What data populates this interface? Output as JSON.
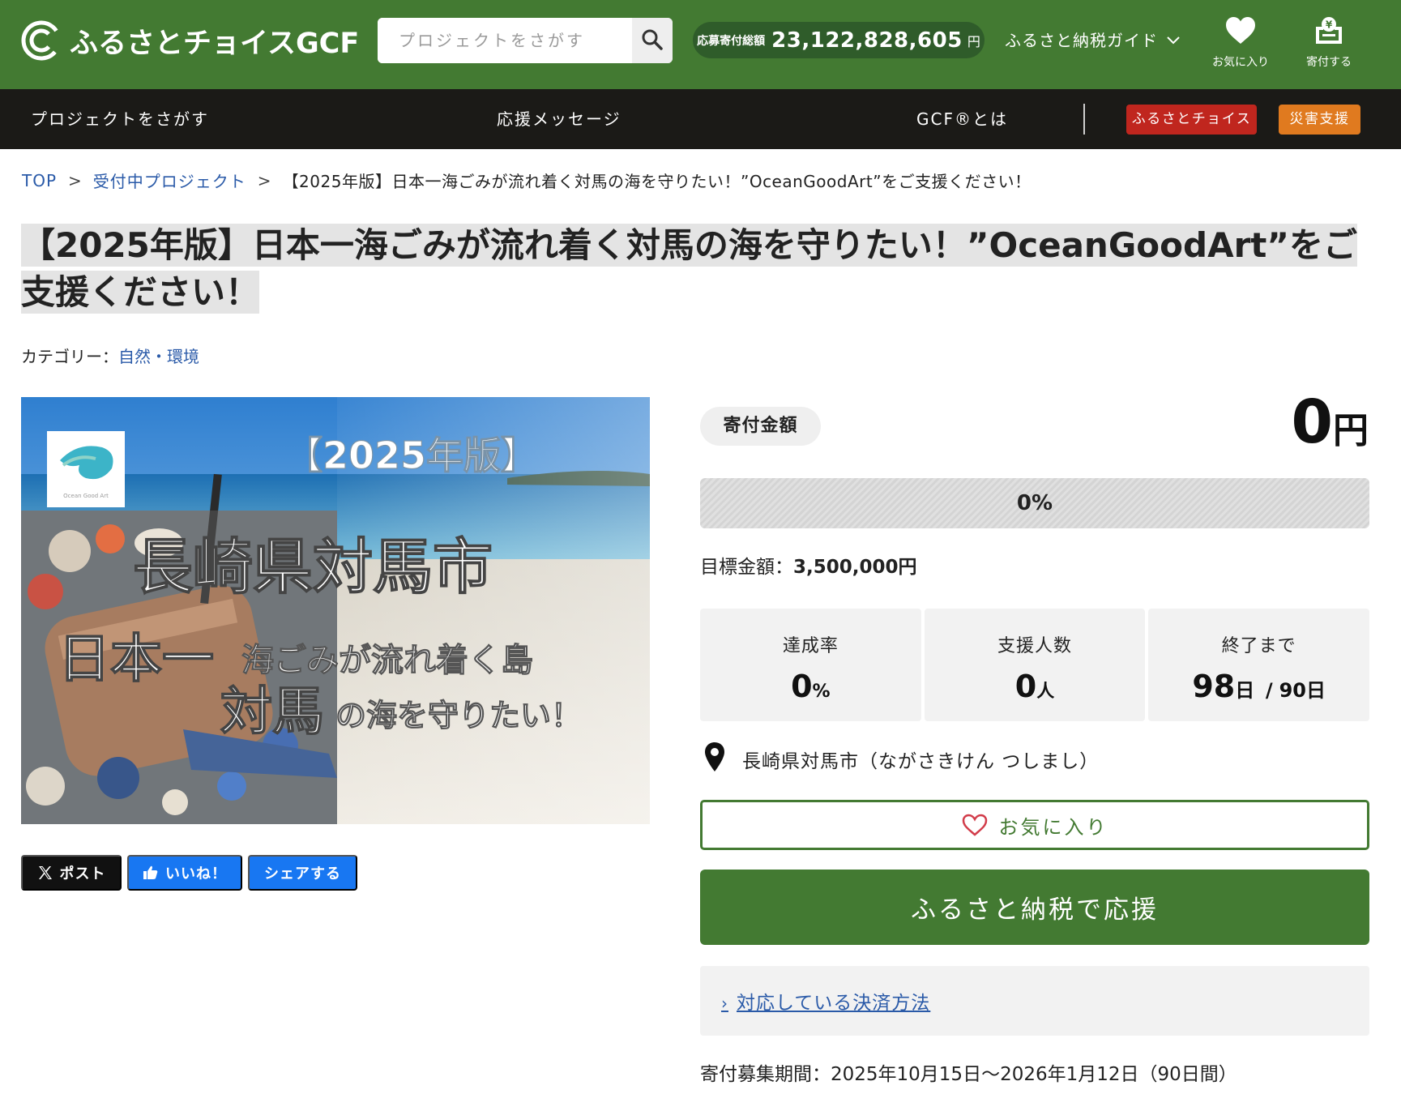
{
  "header": {
    "logo_text": "ふるさとチョイスGCF",
    "search_placeholder": "プロジェクトをさがす",
    "total_label": "応募寄付総額",
    "total_value": "23,122,828,605",
    "total_unit": "円",
    "guide_label": "ふるさと納税ガイド",
    "favorites_label": "お気に入り",
    "donate_label": "寄付する"
  },
  "nav": {
    "items": [
      "プロジェクトをさがす",
      "応援メッセージ",
      "GCF®とは"
    ],
    "choice_button": "ふるさとチョイス",
    "disaster_button": "災害支援",
    "colors": {
      "choice": "#c0261e",
      "disaster": "#e07a1f"
    }
  },
  "breadcrumb": {
    "top": "TOP",
    "sep": ">",
    "accepting": "受付中プロジェクト",
    "current": "【2025年版】日本一海ごみが流れ着く対馬の海を守りたい！”OceanGoodArt”をご支援ください！"
  },
  "project": {
    "title": "【2025年版】日本一海ごみが流れ着く対馬の海を守りたい！”OceanGoodArt”をご支援ください！",
    "category_label": "カテゴリー：",
    "category_value": "自然・環境"
  },
  "hero": {
    "logo_caption": "Ocean Good Art",
    "badge": "【2025年版】",
    "line1": "長崎県対馬市",
    "line2a": "日本一",
    "line2b": "海ごみが流れ着く島",
    "line3a": "対馬",
    "line3b": "の海を守りたい！"
  },
  "share": {
    "post": "ポスト",
    "like": "いいね！",
    "share": "シェアする",
    "colors": {
      "post": "#111111",
      "like": "#1877f2",
      "share": "#1877f2"
    }
  },
  "funding": {
    "amount_label": "寄付金額",
    "amount_value": "0",
    "amount_unit": "円",
    "progress_fraction": 0,
    "progress_text": "0%",
    "goal_label": "目標金額：",
    "goal_value": "3,500,000円",
    "stats": {
      "rate_label": "達成率",
      "rate_value": "0",
      "rate_unit": "%",
      "supporters_label": "支援人数",
      "supporters_value": "0",
      "supporters_unit": "人",
      "remaining_label": "終了まで",
      "remaining_value": "98",
      "remaining_unit": "日",
      "remaining_sep": "/",
      "total_days": "90日"
    },
    "location": "長崎県対馬市（ながさきけん つしまし）",
    "favorite_button": "お気に入り",
    "donate_button": "ふるさと納税で応援",
    "payment_link": "対応している決済方法",
    "period": "寄付募集期間：2025年10月15日〜2026年1月12日（90日間）"
  },
  "colors": {
    "brand_green": "#437a32",
    "dark_green": "#2f5c2a",
    "nav_dark": "#1b1a17",
    "link_blue": "#2a5aa8"
  }
}
